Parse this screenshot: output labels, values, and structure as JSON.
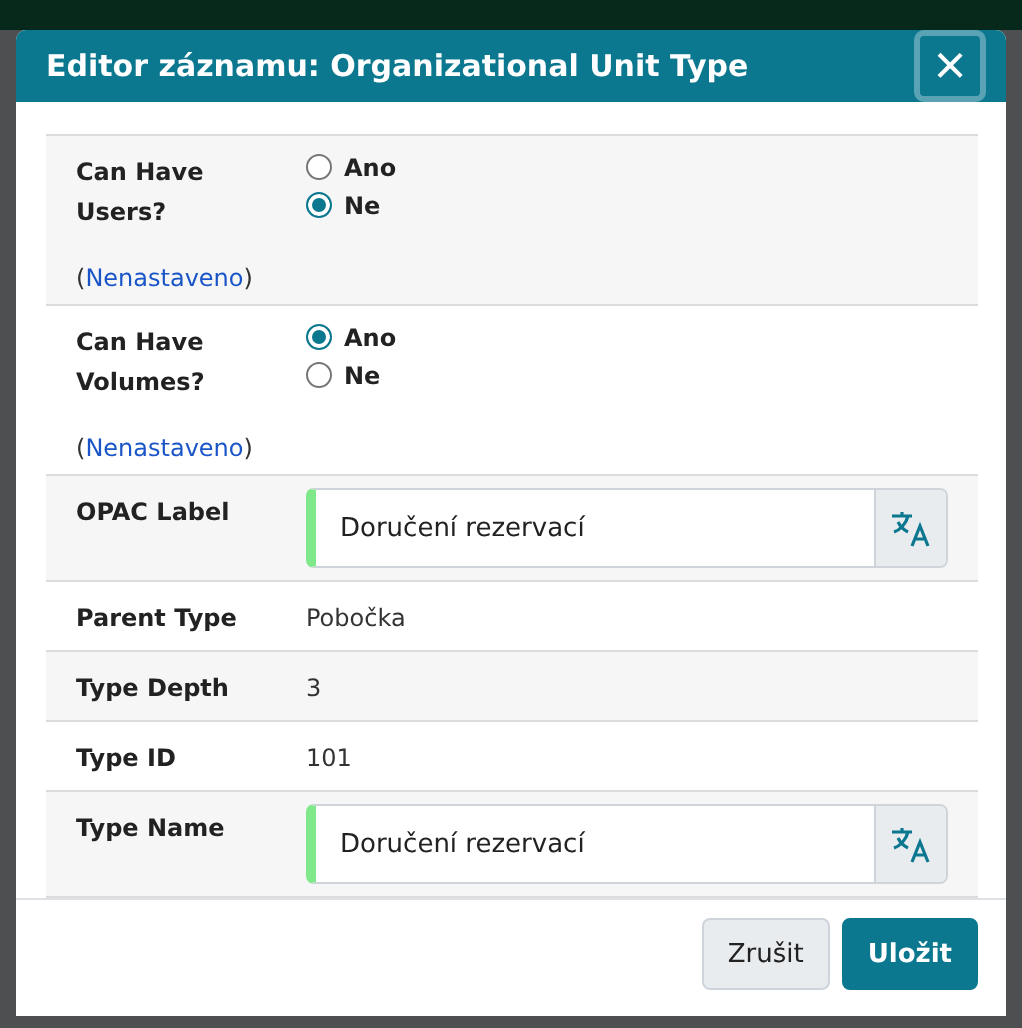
{
  "dialog": {
    "title": "Editor záznamu: Organizational Unit Type",
    "close": "×"
  },
  "fields": [
    {
      "kind": "radio",
      "label": "Can Have Users?",
      "options": [
        {
          "label": "Ano",
          "selected": false
        },
        {
          "label": "Ne",
          "selected": true
        }
      ],
      "unset_link": {
        "open": "(",
        "text": "Nenastaveno",
        "close": ")"
      }
    },
    {
      "kind": "radio",
      "label": "Can Have Volumes?",
      "options": [
        {
          "label": "Ano",
          "selected": true
        },
        {
          "label": "Ne",
          "selected": false
        }
      ],
      "unset_link": {
        "open": "(",
        "text": "Nenastaveno",
        "close": ")"
      }
    },
    {
      "kind": "i18n",
      "label": "OPAC Label",
      "value": "Doručení rezervací"
    },
    {
      "kind": "text",
      "label": "Parent Type",
      "value": "Pobočka"
    },
    {
      "kind": "text",
      "label": "Type Depth",
      "value": "3"
    },
    {
      "kind": "text",
      "label": "Type ID",
      "value": "101"
    },
    {
      "kind": "i18n",
      "label": "Type Name",
      "value": "Doručení rezervací"
    }
  ],
  "buttons": [
    {
      "label": "Zrušit",
      "kind": "secondary"
    },
    {
      "label": "Uložit",
      "kind": "primary"
    }
  ]
}
